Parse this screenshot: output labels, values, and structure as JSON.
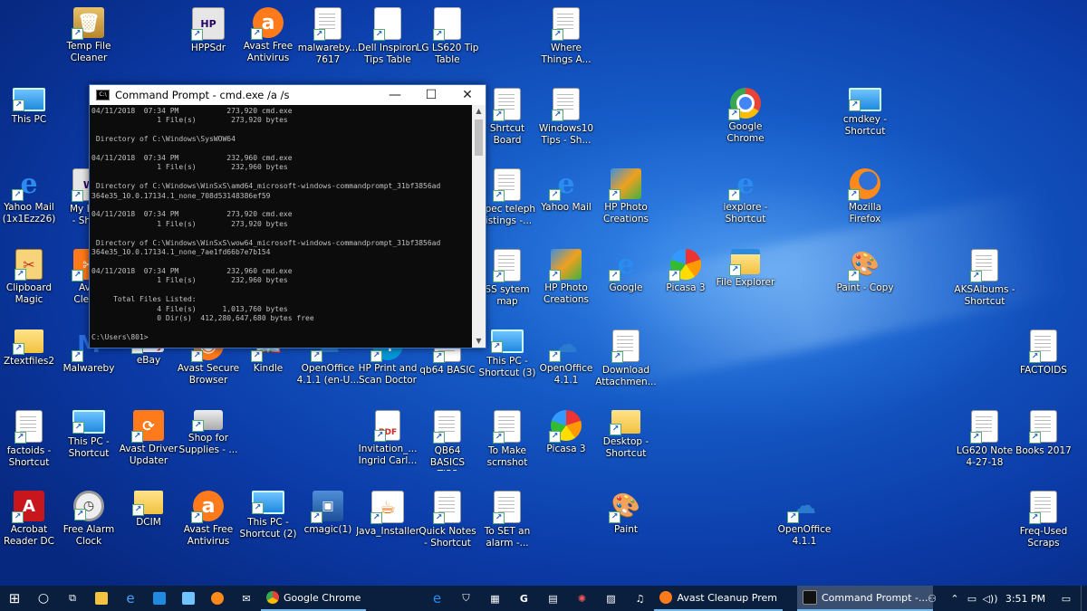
{
  "desktop": {
    "icons": [
      {
        "id": "temp-file-cleaner",
        "label": "Temp File\nCleaner",
        "kind": "temp",
        "glyph": "🗑"
      },
      {
        "id": "hppsdr",
        "label": "HPPSdr",
        "kind": "hppsdr",
        "glyph": "HP"
      },
      {
        "id": "avast-free-antivirus-top",
        "label": "Avast Free\nAntivirus",
        "kind": "avast",
        "glyph": "a"
      },
      {
        "id": "malwarebytes-7617",
        "label": "malwareby...\n7617",
        "kind": "doc",
        "glyph": ""
      },
      {
        "id": "dell-inspiron",
        "label": "Dell Inspiron\nTips Table",
        "kind": "blank",
        "glyph": ""
      },
      {
        "id": "lg-ls620",
        "label": "LG LS620 Tip\nTable",
        "kind": "blank",
        "glyph": ""
      },
      {
        "id": "where-things",
        "label": "Where\nThings A...",
        "kind": "doc",
        "glyph": ""
      },
      {
        "id": "this-pc",
        "label": "This PC",
        "kind": "pc",
        "glyph": ""
      },
      {
        "id": "shrtcut-board",
        "label": "Shrtcut\nBoard",
        "kind": "doc",
        "glyph": ""
      },
      {
        "id": "windows10-tips",
        "label": "Windows10\nTips - Sh...",
        "kind": "doc",
        "glyph": ""
      },
      {
        "id": "google-chrome",
        "label": "Google\nChrome",
        "kind": "chrome",
        "glyph": ""
      },
      {
        "id": "cmdkey-shortcut",
        "label": "cmdkey -\nShortcut",
        "kind": "pc",
        "glyph": ""
      },
      {
        "id": "yahoo-mail-1",
        "label": "Yahoo Mail\n(1x1Ezz26)",
        "kind": "ie",
        "glyph": "e"
      },
      {
        "id": "my-bo",
        "label": "My Bo...\n- Sho...",
        "kind": "hppsdr",
        "glyph": "W"
      },
      {
        "id": "spec-teleph",
        "label": "Spec teleph\nlistings -...",
        "kind": "doc",
        "glyph": ""
      },
      {
        "id": "yahoo-mail-2",
        "label": "Yahoo Mail",
        "kind": "ie",
        "glyph": "e"
      },
      {
        "id": "hp-photo-1",
        "label": "HP Photo\nCreations",
        "kind": "pp",
        "glyph": ""
      },
      {
        "id": "iexplore-shortcut",
        "label": "iexplore -\nShortcut",
        "kind": "ie",
        "glyph": "e"
      },
      {
        "id": "mozilla-firefox",
        "label": "Mozilla\nFirefox",
        "kind": "ff",
        "glyph": ""
      },
      {
        "id": "clipboard-magic",
        "label": "Clipboard\nMagic",
        "kind": "clip",
        "glyph": "✂"
      },
      {
        "id": "av-clea",
        "label": "Av...\nClea...",
        "kind": "avdrv",
        "glyph": "✂"
      },
      {
        "id": "ss-sytem-map",
        "label": "SS sytem\nmap",
        "kind": "doc",
        "glyph": ""
      },
      {
        "id": "hp-photo-2",
        "label": "HP Photo\nCreations",
        "kind": "pp",
        "glyph": ""
      },
      {
        "id": "google",
        "label": "Google",
        "kind": "ie",
        "glyph": "e"
      },
      {
        "id": "picasa-3-top",
        "label": "Picasa 3",
        "kind": "picasa",
        "glyph": ""
      },
      {
        "id": "file-explorer",
        "label": "File Explorer",
        "kind": "explorer",
        "glyph": ""
      },
      {
        "id": "paint-copy",
        "label": "Paint - Copy",
        "kind": "paint",
        "glyph": "🎨"
      },
      {
        "id": "aksalbums",
        "label": "AKSAlbums -\nShortcut",
        "kind": "doc",
        "glyph": ""
      },
      {
        "id": "ztextfiles2",
        "label": "Ztextfiles2",
        "kind": "folder",
        "glyph": ""
      },
      {
        "id": "malwareby",
        "label": "Malwareby",
        "kind": "mal",
        "glyph": "M"
      },
      {
        "id": "ebay",
        "label": "eBay",
        "kind": "ebay",
        "glyph": "ebay"
      },
      {
        "id": "avast-secure-browser",
        "label": "Avast Secure\nBrowser",
        "kind": "avast",
        "glyph": "◉"
      },
      {
        "id": "kindle",
        "label": "Kindle",
        "kind": "kindle",
        "glyph": "📖"
      },
      {
        "id": "openoffice-en",
        "label": "OpenOffice\n4.1.1 (en-U...",
        "kind": "oo",
        "glyph": "☁"
      },
      {
        "id": "hp-print-scan",
        "label": "HP Print and\nScan Doctor",
        "kind": "hpsc",
        "glyph": "hp"
      },
      {
        "id": "qb64-basic",
        "label": "qb64 BASIC",
        "kind": "doc",
        "glyph": ""
      },
      {
        "id": "this-pc-shortcut-3",
        "label": "This PC -\nShortcut (3)",
        "kind": "pc",
        "glyph": ""
      },
      {
        "id": "openoffice-411-mid",
        "label": "OpenOffice\n4.1.1",
        "kind": "oo",
        "glyph": "☁"
      },
      {
        "id": "download-attachmen",
        "label": "Download\nAttachmen...",
        "kind": "doc",
        "glyph": ""
      },
      {
        "id": "factoids",
        "label": "FACTOIDS",
        "kind": "doc",
        "glyph": ""
      },
      {
        "id": "factoids-shortcut",
        "label": "factoids -\nShortcut",
        "kind": "doc",
        "glyph": ""
      },
      {
        "id": "this-pc-shortcut",
        "label": "This PC -\nShortcut",
        "kind": "pc",
        "glyph": ""
      },
      {
        "id": "avast-driver-updater",
        "label": "Avast Driver\nUpdater",
        "kind": "avdrv",
        "glyph": "⟳"
      },
      {
        "id": "shop-for-supplies",
        "label": "Shop for\nSupplies - ...",
        "kind": "printer",
        "glyph": ""
      },
      {
        "id": "invitation",
        "label": "Invitation_...\nIngrid Carl...",
        "kind": "pdf",
        "glyph": "PDF"
      },
      {
        "id": "qb64-basics-tips",
        "label": "QB64 BASICS\nTIPS",
        "kind": "doc",
        "glyph": ""
      },
      {
        "id": "to-make-scrnshot",
        "label": "To Make\nscrnshot",
        "kind": "doc",
        "glyph": ""
      },
      {
        "id": "picasa-3-mid",
        "label": "Picasa 3",
        "kind": "picasa",
        "glyph": ""
      },
      {
        "id": "desktop-shortcut",
        "label": "Desktop -\nShortcut",
        "kind": "folder",
        "glyph": ""
      },
      {
        "id": "lg620-note",
        "label": "LG620 Note\n4-27-18",
        "kind": "doc",
        "glyph": ""
      },
      {
        "id": "books-2017",
        "label": "Books 2017",
        "kind": "doc",
        "glyph": ""
      },
      {
        "id": "acrobat-reader",
        "label": "Acrobat\nReader DC",
        "kind": "red",
        "glyph": "A"
      },
      {
        "id": "free-alarm-clock",
        "label": "Free Alarm\nClock",
        "kind": "clock",
        "glyph": "◷"
      },
      {
        "id": "dcim",
        "label": "DCIM",
        "kind": "folder",
        "glyph": ""
      },
      {
        "id": "avast-free-antivirus-bot",
        "label": "Avast Free\nAntivirus",
        "kind": "avast",
        "glyph": "a"
      },
      {
        "id": "this-pc-shortcut-2",
        "label": "This PC -\nShortcut (2)",
        "kind": "pc",
        "glyph": ""
      },
      {
        "id": "cmagic",
        "label": "cmagic(1)",
        "kind": "cmagic",
        "glyph": "▣"
      },
      {
        "id": "java-installer",
        "label": "Java_Installer",
        "kind": "java",
        "glyph": "☕"
      },
      {
        "id": "quick-notes",
        "label": "Quick Notes\n- Shortcut",
        "kind": "doc",
        "glyph": ""
      },
      {
        "id": "to-set-alarm",
        "label": "To SET an\nalarm -...",
        "kind": "doc",
        "glyph": ""
      },
      {
        "id": "paint",
        "label": "Paint",
        "kind": "paint",
        "glyph": "🎨"
      },
      {
        "id": "openoffice-411-bot",
        "label": "OpenOffice\n4.1.1",
        "kind": "oo",
        "glyph": "☁"
      },
      {
        "id": "freq-used-scraps",
        "label": "Freq-Used\nScraps",
        "kind": "doc",
        "glyph": ""
      }
    ]
  },
  "cmd_window": {
    "title": "Command Prompt - cmd.exe  /a /s",
    "icon_text": "C:\\",
    "minimize": "—",
    "maximize": "☐",
    "close": "✕",
    "lines": [
      "04/11/2018  07:34 PM           273,920 cmd.exe",
      "               1 File(s)        273,920 bytes",
      "",
      " Directory of C:\\Windows\\SysWOW64",
      "",
      "04/11/2018  07:34 PM           232,960 cmd.exe",
      "               1 File(s)        232,960 bytes",
      "",
      " Directory of C:\\Windows\\WinSxS\\amd64_microsoft-windows-commandprompt_31bf3856ad",
      "364e35_10.0.17134.1_none_708d53148386ef59",
      "",
      "04/11/2018  07:34 PM           273,920 cmd.exe",
      "               1 File(s)        273,920 bytes",
      "",
      " Directory of C:\\Windows\\WinSxS\\wow64_microsoft-windows-commandprompt_31bf3856ad",
      "364e35_10.0.17134.1_none_7ae1fd66b7e7b154",
      "",
      "04/11/2018  07:34 PM           232,960 cmd.exe",
      "               1 File(s)        232,960 bytes",
      "",
      "     Total Files Listed:",
      "               4 File(s)      1,013,760 bytes",
      "               0 Dir(s)  412,280,647,680 bytes free",
      "",
      "C:\\Users\\801>"
    ]
  },
  "taskbar": {
    "start_icon": "windows-logo-icon",
    "apps": [
      {
        "label": "Google Chrome",
        "color": "#34a853"
      },
      {
        "label": "Avast Cleanup Prem",
        "color": "#ff7a1a"
      },
      {
        "label": "Command Prompt -...",
        "color": "#111111"
      }
    ],
    "clock": "3:51 PM"
  }
}
